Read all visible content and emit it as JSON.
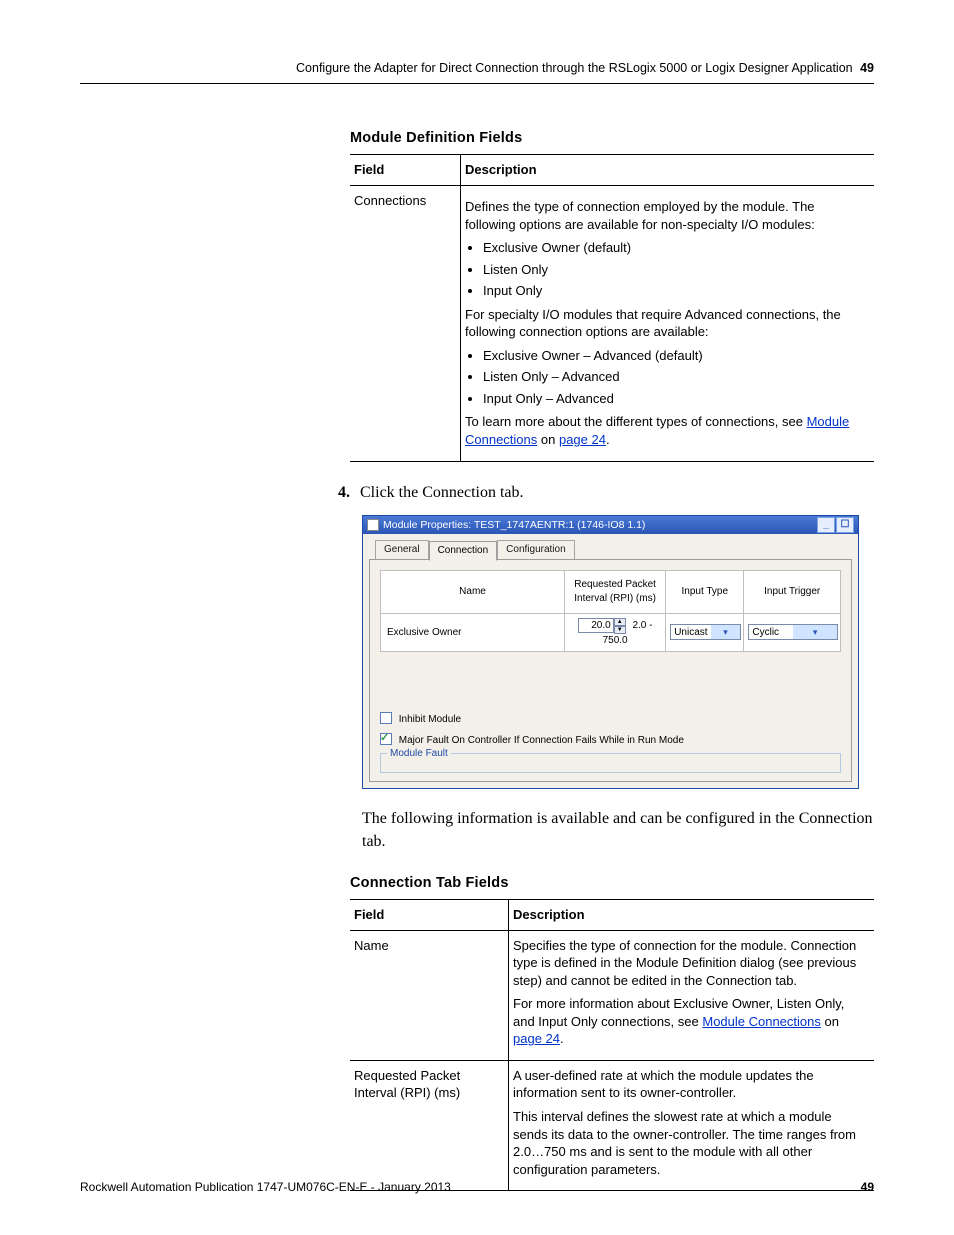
{
  "running_header": {
    "title": "Configure the Adapter for Direct Connection through the RSLogix 5000 or Logix Designer Application",
    "page": "49"
  },
  "module_definition": {
    "title": "Module Definition Fields",
    "col_field": "Field",
    "col_desc": "Description",
    "row": {
      "field": "Connections",
      "para1": "Defines the type of connection employed by the module. The following options are available for non-specialty I/O modules:",
      "bullets1": [
        "Exclusive Owner (default)",
        "Listen Only",
        "Input Only"
      ],
      "para2": "For specialty I/O modules that require Advanced connections, the following connection options are available:",
      "bullets2": [
        "Exclusive Owner – Advanced (default)",
        "Listen Only – Advanced",
        "Input Only – Advanced"
      ],
      "para3_prefix": "To learn more about the different types of connections, see ",
      "link1": "Module Connections",
      "para3_mid": " on ",
      "link2": "page 24",
      "para3_suffix": "."
    }
  },
  "step4": {
    "num": "4.",
    "text": "Click the Connection tab."
  },
  "screenshot": {
    "title": "Module Properties: TEST_1747AENTR:1 (1746-IO8 1.1)",
    "tabs": {
      "general": "General",
      "connection": "Connection",
      "configuration": "Configuration"
    },
    "grid_headers": {
      "name": "Name",
      "rpi": "Requested Packet Interval (RPI) (ms)",
      "input_type": "Input Type",
      "input_trigger": "Input Trigger"
    },
    "grid_row": {
      "name": "Exclusive Owner",
      "rpi_value": "20.0",
      "rpi_range": "2.0 - 750.0",
      "input_type": "Unicast",
      "input_trigger": "Cyclic"
    },
    "chk1": "Inhibit Module",
    "chk2": "Major Fault On Controller If Connection Fails While in Run Mode",
    "fieldset": "Module Fault"
  },
  "body_text": "The following information is available and can be configured in the Connection tab.",
  "connection_tab": {
    "title": "Connection Tab Fields",
    "col_field": "Field",
    "col_desc": "Description",
    "rows": {
      "r1": {
        "field": "Name",
        "p1": "Specifies the type of connection for the module. Connection type is defined in the Module Definition dialog (see previous step) and cannot be edited in the Connection tab.",
        "p2_prefix": "For more information about Exclusive Owner, Listen Only, and Input Only connections, see ",
        "link1": "Module Connections",
        "p2_mid": " on ",
        "link2": "page 24",
        "p2_suffix": "."
      },
      "r2": {
        "field": "Requested Packet Interval (RPI) (ms)",
        "p1": "A user-defined rate at which the module updates the information sent to its owner-controller.",
        "p2": "This interval defines the slowest rate at which a module sends its data to the owner-controller. The time ranges from 2.0…750 ms and is sent to the module with all other configuration parameters."
      }
    }
  },
  "footer": {
    "pub": "Rockwell Automation Publication 1747-UM076C-EN-E - January 2013",
    "page": "49"
  }
}
